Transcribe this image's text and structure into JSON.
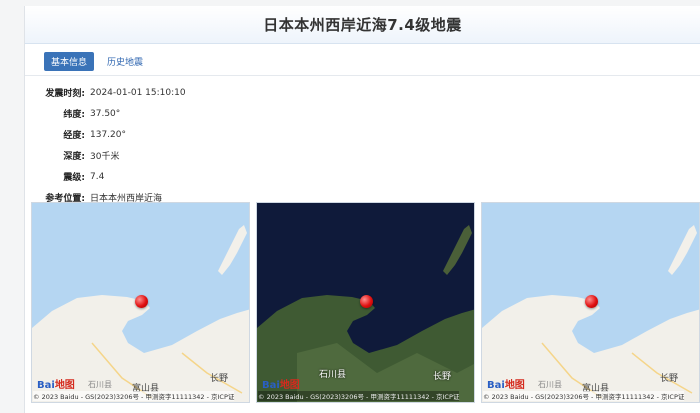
{
  "title": "日本本州西岸近海7.4级地震",
  "tabs": [
    {
      "label": "基本信息",
      "active": true
    },
    {
      "label": "历史地震",
      "active": false
    }
  ],
  "info": [
    {
      "label": "发震时刻:",
      "value": "2024-01-01 15:10:10"
    },
    {
      "label": "纬度:",
      "value": "37.50°"
    },
    {
      "label": "经度:",
      "value": "137.20°"
    },
    {
      "label": "深度:",
      "value": "30千米"
    },
    {
      "label": "震级:",
      "value": "7.4"
    },
    {
      "label": "参考位置:",
      "value": "日本本州西岸近海"
    }
  ],
  "maps": [
    {
      "style": "standard",
      "city_main": "富山县",
      "city_right": "长野",
      "city_small": "石川县",
      "logo_a": "Bai",
      "logo_b": "地图",
      "copyright": "© 2023 Baidu - GS(2023)3206号 - 甲测资字11111342 - 京ICP证"
    },
    {
      "style": "satellite",
      "city_main": "石川县",
      "city_right": "长野",
      "city_small": "",
      "logo_a": "Bai",
      "logo_b": "地图",
      "copyright": "© 2023 Baidu - GS(2023)3206号 - 甲测资字11111342 - 京ICP证"
    },
    {
      "style": "standard",
      "city_main": "富山县",
      "city_right": "长野",
      "city_small": "石川县",
      "logo_a": "Bai",
      "logo_b": "地图",
      "copyright": "© 2023 Baidu - GS(2023)3206号 - 甲测资字11111342 - 京ICP证"
    }
  ],
  "colors": {
    "sea": "#b5d6f2",
    "land": "#f2f0ea",
    "tab_active": "#3a73b8",
    "pin": "#e01010"
  }
}
